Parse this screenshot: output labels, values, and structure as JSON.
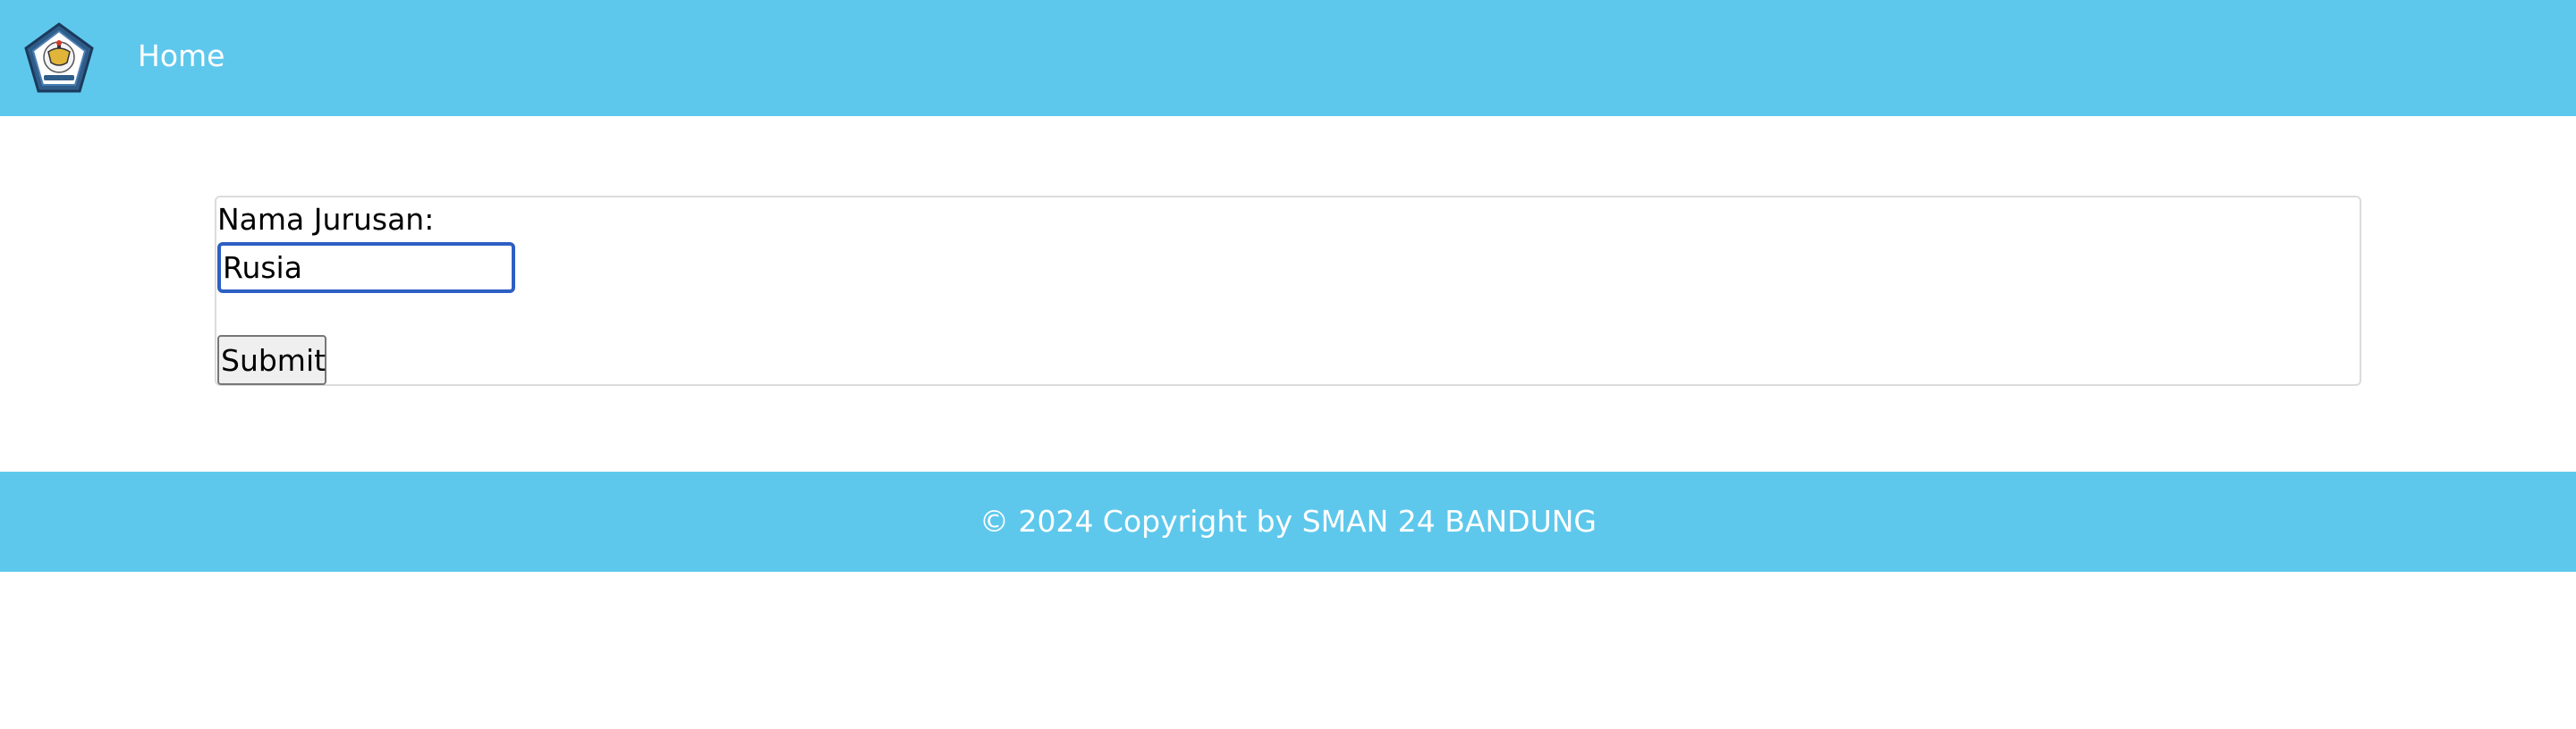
{
  "navbar": {
    "logo_name": "school-emblem",
    "home_label": "Home",
    "background_color": "#5ec8ec"
  },
  "form": {
    "label": "Nama Jurusan:",
    "input_value": "Rusia",
    "submit_label": "Submit"
  },
  "footer": {
    "text": "© 2024 Copyright by SMAN 24 BANDUNG",
    "background_color": "#5ec8ec"
  }
}
